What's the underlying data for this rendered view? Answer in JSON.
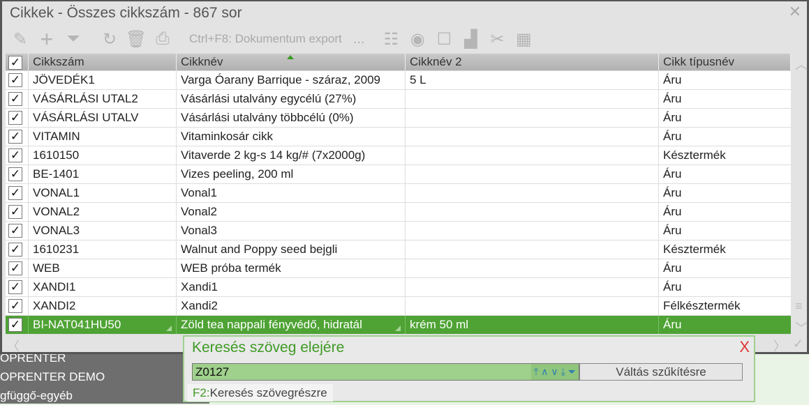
{
  "background_list": [
    "OPRENTER",
    "OPRENTER DEMO",
    "gfüggő-egyéb"
  ],
  "window": {
    "title": "Cikkek - Összes cikkszám - 867 sor",
    "close": "✕"
  },
  "toolbar": {
    "export_label": "Ctrl+F8: Dokumentum export",
    "more": "..."
  },
  "columns": [
    "✓",
    "Cikkszám",
    "Cikknév",
    "Cikknév 2",
    "Cikk típusnév"
  ],
  "rows": [
    {
      "check": "✓",
      "code": "JÖVEDÉK1",
      "name": "Varga Óarany Barrique - száraz, 2009",
      "name2": "5 L",
      "type": "Áru"
    },
    {
      "check": "✓",
      "code": "VÁSÁRLÁSI UTAL2",
      "name": "Vásárlási utalvány egycélú (27%)",
      "name2": "",
      "type": "Áru"
    },
    {
      "check": "✓",
      "code": "VÁSÁRLÁSI UTALV",
      "name": "Vásárlási utalvány többcélú (0%)",
      "name2": "",
      "type": "Áru"
    },
    {
      "check": "✓",
      "code": "VITAMIN",
      "name": "Vitaminkosár cikk",
      "name2": "",
      "type": "Áru"
    },
    {
      "check": "✓",
      "code": "1610150",
      "name": "Vitaverde 2 kg-s  14 kg/# (7x2000g)",
      "name2": "",
      "type": "Késztermék"
    },
    {
      "check": "✓",
      "code": "BE-1401",
      "name": "Vizes peeling, 200 ml",
      "name2": "",
      "type": "Áru"
    },
    {
      "check": "✓",
      "code": "VONAL1",
      "name": "Vonal1",
      "name2": "",
      "type": "Áru"
    },
    {
      "check": "✓",
      "code": "VONAL2",
      "name": "Vonal2",
      "name2": "",
      "type": "Áru"
    },
    {
      "check": "✓",
      "code": "VONAL3",
      "name": "Vonal3",
      "name2": "",
      "type": "Áru"
    },
    {
      "check": "✓",
      "code": "1610231",
      "name": "Walnut and Poppy seed bejgli",
      "name2": "",
      "type": "Késztermék"
    },
    {
      "check": "✓",
      "code": "WEB",
      "name": "WEB próba termék",
      "name2": "",
      "type": "Áru"
    },
    {
      "check": "✓",
      "code": "XANDI1",
      "name": "Xandi1",
      "name2": "",
      "type": "Áru"
    },
    {
      "check": "✓",
      "code": "XANDI2",
      "name": "Xandi2",
      "name2": "",
      "type": "Félkésztermék"
    },
    {
      "check": "✓",
      "code": "BI-NAT041HU50",
      "name": "Zöld tea nappali fényvédő, hidratál",
      "name2": "krém 50 ml",
      "type": "Áru",
      "selected": true
    }
  ],
  "search": {
    "title": "Keresés szöveg elejére",
    "value": "Z0127",
    "switch_button": "Váltás szűkítésre",
    "hint_key": "F2:",
    "hint_text": "Keresés szövegrészre",
    "close": "X"
  },
  "colors": {
    "accent": "#4ea334",
    "title_green": "#3f9a25"
  }
}
